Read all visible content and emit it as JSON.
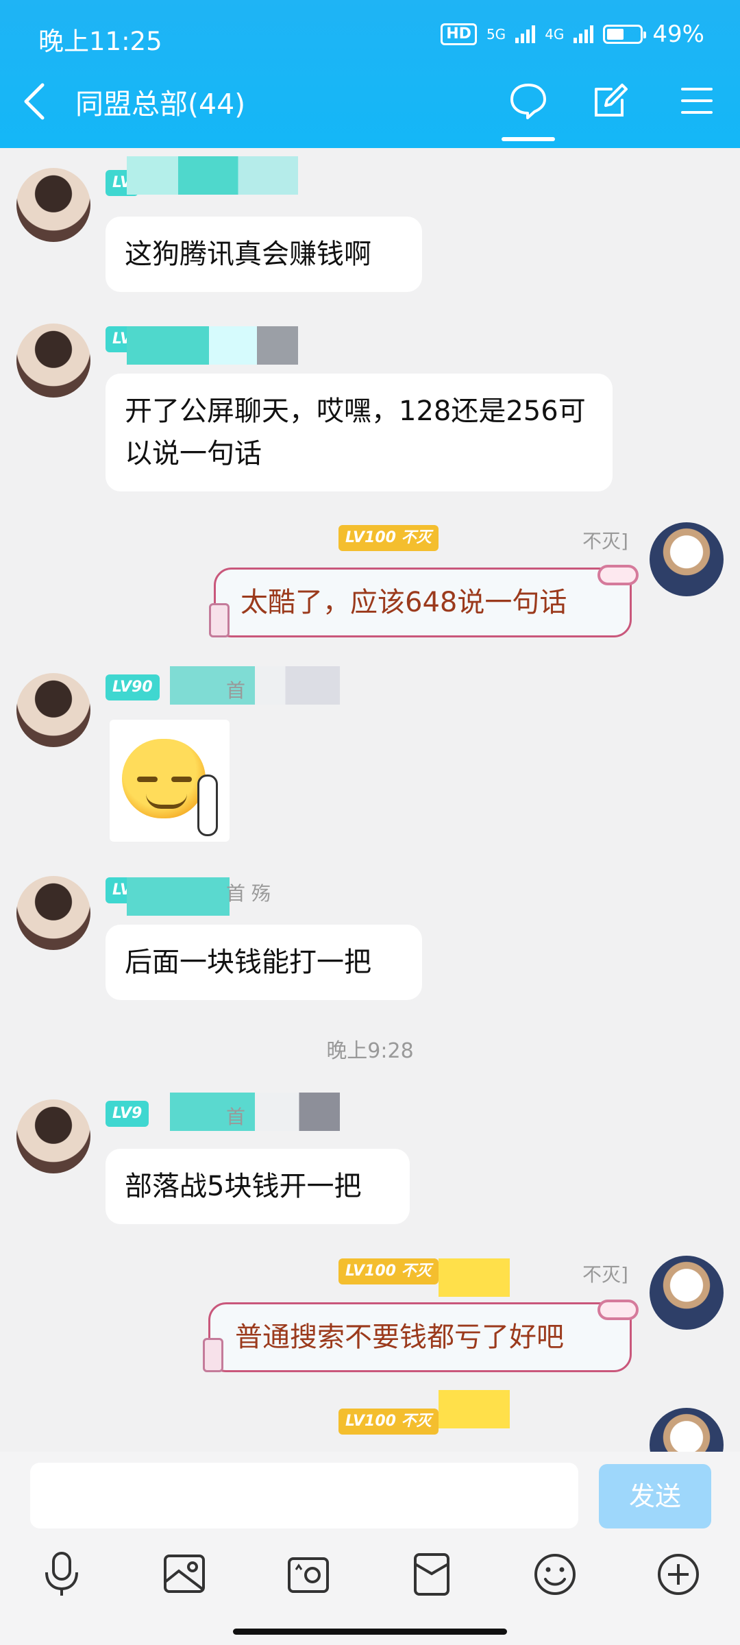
{
  "status_bar": {
    "time": "晚上11:25",
    "hd": "HD",
    "net1": "5G",
    "net2": "4G",
    "battery": "49%"
  },
  "header": {
    "title": "同盟总部(44)"
  },
  "messages": [
    {
      "side": "left",
      "level": "LV",
      "text": "这狗腾讯真会赚钱啊"
    },
    {
      "side": "left",
      "level": "LV",
      "text": "开了公屏聊天，哎嘿，128还是256可以说一句话"
    },
    {
      "side": "right",
      "level": "LV100 不灭",
      "nick_tail": "不灭]",
      "text": "太酷了，应该648说一句话"
    },
    {
      "side": "left",
      "level": "LV90",
      "nick_tail": "首",
      "sticker": "smirk-emoji"
    },
    {
      "side": "left",
      "level": "LV9",
      "nick_tail": "首  殇",
      "text": "后面一块钱能打一把"
    },
    {
      "side": "left",
      "level": "LV9",
      "nick_tail": "首",
      "text": "部落战5块钱开一把"
    },
    {
      "side": "right",
      "level": "LV100 不灭",
      "nick_tail": "不灭]",
      "text": "普通搜索不要钱都亏了好吧"
    },
    {
      "side": "right",
      "level": "LV100 不灭"
    }
  ],
  "timestamp": "晚上9:28",
  "input": {
    "placeholder": "",
    "send_label": "发送"
  },
  "toolbar_icons": [
    "mic-icon",
    "image-icon",
    "camera-icon",
    "red-packet-icon",
    "emoji-icon",
    "plus-icon"
  ],
  "colors": {
    "header": "#14b7f7",
    "self_bubble_border": "#c9577b",
    "self_bubble_text": "#9b3a1c",
    "level_badge_teal": "#3fd7d0",
    "level_badge_gold": "#f4be2e",
    "send_button": "#9ed7fb"
  }
}
